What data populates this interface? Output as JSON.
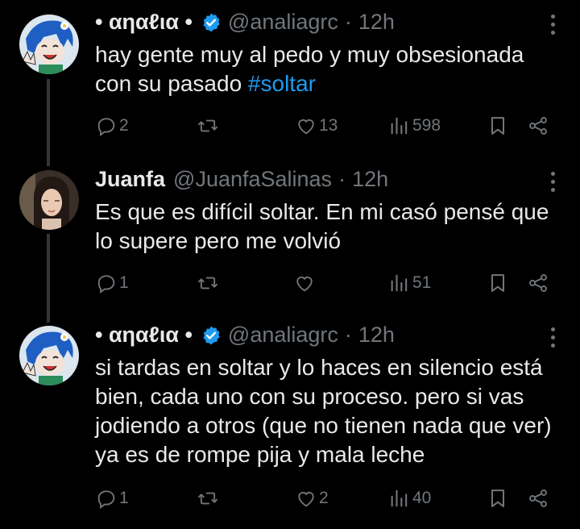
{
  "tweets": [
    {
      "name": "• αηαℓια •",
      "handle": "@analiagrc",
      "dot": "·",
      "time": "12h",
      "text_plain": "hay gente muy al pedo y muy obsesionada con su pasado ",
      "hashtag": "#soltar",
      "replies": "2",
      "retweets": "",
      "likes": "13",
      "views": "598"
    },
    {
      "name": "Juanfa",
      "handle": "@JuanfaSalinas",
      "dot": "·",
      "time": "12h",
      "text_plain": "Es que es difícil soltar. En mi casó pensé que lo supere pero me volvió",
      "replies": "1",
      "retweets": "",
      "likes": "",
      "views": "51"
    },
    {
      "name": "• αηαℓια •",
      "handle": "@analiagrc",
      "dot": "·",
      "time": "12h",
      "text_plain": "si tardas en soltar y lo haces en silencio está bien, cada uno con su proceso. pero si vas jodiendo a otros (que no tienen nada que ver) ya es de rompe pija y mala leche",
      "replies": "1",
      "retweets": "",
      "likes": "2",
      "views": "40"
    }
  ],
  "colors": {
    "accent": "#1d9bf0",
    "muted": "#71767b",
    "text": "#e7e9ea",
    "background": "#000000"
  }
}
